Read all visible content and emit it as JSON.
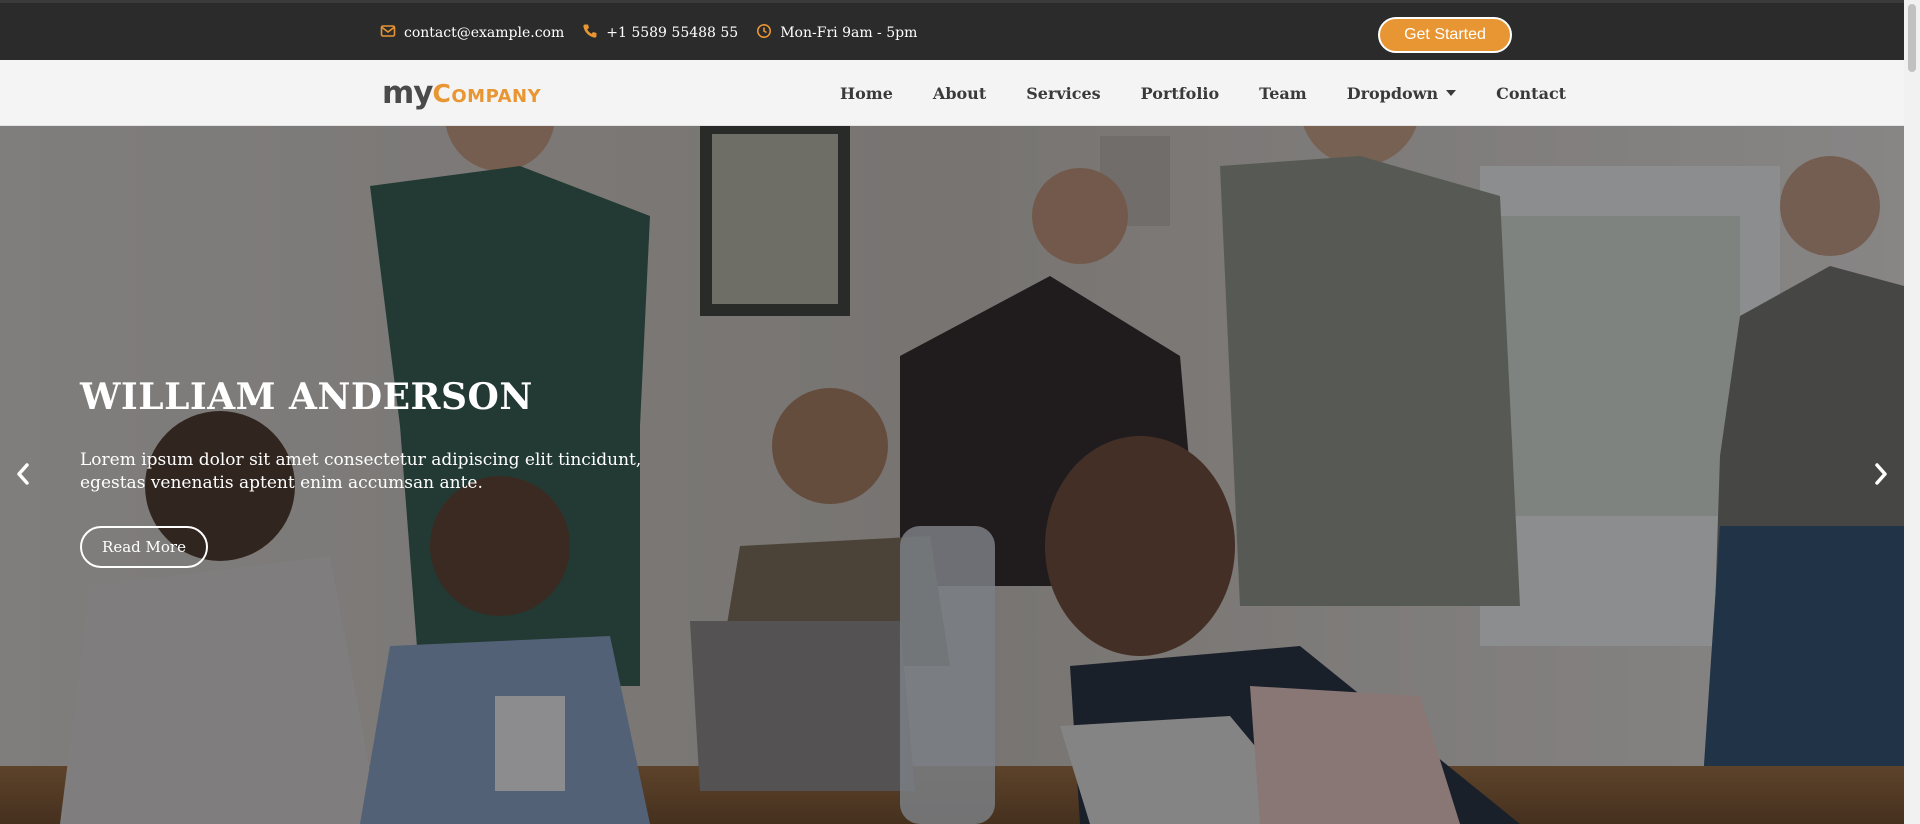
{
  "topbar": {
    "email": "contact@example.com",
    "phone": "+1 5589 55488 55",
    "hours": "Mon-Fri 9am - 5pm",
    "cta_label": "Get Started",
    "icon_names": [
      "envelope-icon",
      "phone-icon",
      "clock-icon"
    ],
    "icon_color": "#e89634"
  },
  "header": {
    "logo_my": "my",
    "logo_company": "Company",
    "nav": [
      {
        "label": "Home"
      },
      {
        "label": "About"
      },
      {
        "label": "Services"
      },
      {
        "label": "Portfolio"
      },
      {
        "label": "Team"
      },
      {
        "label": "Dropdown"
      },
      {
        "label": "Contact"
      }
    ]
  },
  "hero": {
    "title": "WILLIAM ANDERSON",
    "text": "Lorem ipsum dolor sit amet consectetur adipiscing elit tincidunt, egestas venenatis aptent enim accumsan ante.",
    "button_label": "Read More",
    "prev_icon": "chevron-left-icon",
    "next_icon": "chevron-right-icon"
  },
  "colors": {
    "accent": "#e89634",
    "topbar_bg": "#2b2b2b",
    "header_bg": "#f4f4f4"
  }
}
